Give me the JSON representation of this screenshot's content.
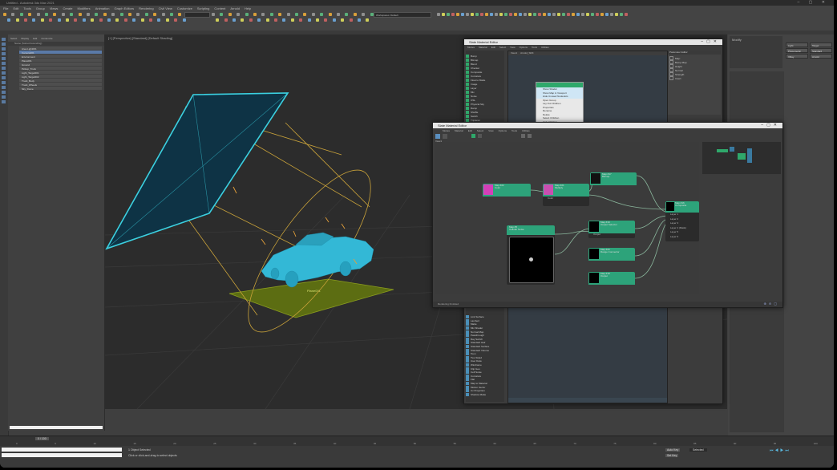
{
  "app": {
    "title": "Untitled - Autodesk 3ds Max 2021",
    "workspace_label": "Workspaces: Default",
    "menus": [
      "File",
      "Edit",
      "Tools",
      "Group",
      "Views",
      "Create",
      "Modifiers",
      "Animation",
      "Graph Editors",
      "Rendering",
      "Civil View",
      "Customize",
      "Scripting",
      "Content",
      "Arnold",
      "Help"
    ]
  },
  "scene_explorer": {
    "tabs": [
      "Select",
      "Display",
      "Edit",
      "Customize"
    ],
    "column_header": "Name (Sorted Ascending)",
    "rows": [
      "Area Light001",
      "Camera001",
      "Environment",
      "Plane001",
      "Ground",
      "Pickup_Truck",
      "Light_Target001",
      "Light_Target002",
      "Truck_Body",
      "Truck_Wheels",
      "Sky_Dome"
    ]
  },
  "viewport": {
    "label": "[+] [Perspective] [Standard] [Default Shading]",
    "ground_label": "Plane001"
  },
  "slate_back_window": {
    "title": "Slate Material Editor",
    "menus": [
      "Modes",
      "Material",
      "Edit",
      "Select",
      "View",
      "Options",
      "Tools",
      "Utilities"
    ],
    "tabs": [
      "View1",
      "Arnold_SDK"
    ],
    "browser_items": [
      "Bump",
      "Bitmap",
      "Blend",
      "Checker",
      "Composite",
      "Curvature",
      "Float to Matte",
      "Image",
      "Layer",
      "Mix",
      "Noise",
      "OSL",
      "Physical Sky",
      "Ramp",
      "Shuffle",
      "Switch",
      "Triplanar",
      "UV Transform",
      "Utility",
      "Vector Map"
    ],
    "browser_items_lower": [
      "Link Surface",
      "Lambert",
      "Matte",
      "Mix Shader",
      "Normal Map",
      "Passthrough",
      "Ray Switch",
      "Standard Hair",
      "Standard Surface",
      "Standard Volume",
      "Toon",
      "Two Sided",
      "User Data",
      "Wireframe",
      "Clip Geo",
      "Cell Noise",
      "Curvature",
      "Flat",
      "Map to Material",
      "Motion Vector",
      "Uv Projection",
      "Shadow Matte"
    ],
    "context_menu": [
      "Show Shader",
      "Show Map in Viewport",
      "Hide Unused Nodeslots",
      "Open Group",
      "Lay Out Children",
      "Properties",
      "Rename",
      "Delete",
      "Select Children",
      "Hide Children"
    ],
    "param_title": "Parameter Editor",
    "param_rows": [
      "Map:",
      "Bump Map",
      "Height",
      "Normal",
      "Strength",
      "Invert"
    ]
  },
  "slate_front_window": {
    "title": "Slate Material Editor",
    "menus": [
      "Modes",
      "Material",
      "Edit",
      "Select",
      "View",
      "Options",
      "Tools",
      "Utilities"
    ],
    "tab": "View1",
    "footer": "Rendering Finished",
    "nodes": {
      "color_a": {
        "title": "Map #22",
        "sub": "Color"
      },
      "color_b": {
        "title": "Map #21",
        "sub": "Multiply"
      },
      "top_right": {
        "title": "Map #17",
        "sub": "Bitmap"
      },
      "noise": {
        "title": "Map #5",
        "sub": "Cellular Noise"
      },
      "mid_right_1": {
        "title": "Map #19",
        "sub": "Output Selector"
      },
      "mid_right_2": {
        "title": "Map #20",
        "sub": "Range Connector"
      },
      "mid_right_3": {
        "title": "Map #18",
        "sub": "Output"
      },
      "output": {
        "title": "Map #16",
        "sub": "Composite"
      }
    },
    "ports_output": [
      "Layer 1",
      "Layer 2",
      "Layer 3",
      "Layer 4 (Mask)",
      "Layer 5",
      "Layer 6"
    ],
    "port_color_b": "Color",
    "port_mid1": "Output"
  },
  "right_panel": {
    "title": "Modify",
    "buttons": [
      "Light",
      "Target",
      "Photometric",
      "Standard",
      "VRay",
      "Arnold"
    ]
  },
  "timeline": {
    "frame": "0 / 100",
    "ticks": [
      "0",
      "5",
      "10",
      "15",
      "20",
      "25",
      "30",
      "35",
      "40",
      "45",
      "50",
      "55",
      "60",
      "65",
      "70",
      "75",
      "80",
      "85",
      "90",
      "95",
      "100"
    ]
  },
  "status": {
    "selection": "1 Object Selected",
    "prompt": "Click or click-and-drag to select objects",
    "auto_key": "Auto Key",
    "set_key": "Set Key",
    "selected": "Selected"
  },
  "colors": {
    "accent": "#2da37a",
    "cyan": "#3bd0e0",
    "node_magenta": "#d43fb8"
  }
}
